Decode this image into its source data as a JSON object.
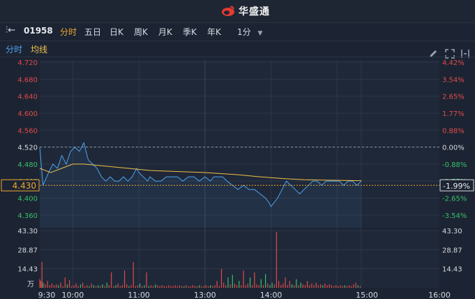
{
  "brand": {
    "name": "华盛通"
  },
  "toolbar": {
    "stock_code": "01958",
    "tabs": [
      {
        "label": "分时",
        "active": true
      },
      {
        "label": "五日",
        "active": false
      },
      {
        "label": "日K",
        "active": false
      },
      {
        "label": "周K",
        "active": false
      },
      {
        "label": "月K",
        "active": false
      },
      {
        "label": "季K",
        "active": false
      },
      {
        "label": "年K",
        "active": false
      }
    ],
    "interval": "1分",
    "icons": [
      "pencil-icon",
      "fullscreen-icon",
      "expand-icon"
    ]
  },
  "legend": {
    "price": "分时",
    "average": "均线"
  },
  "colors": {
    "price_line": "#4ea3f0",
    "avg_line": "#f0c04a",
    "up": "#e24a4a",
    "down": "#38c06a",
    "current": "#f0a632"
  },
  "chart_data": {
    "type": "line",
    "price_ticks": [
      "4.720",
      "4.680",
      "4.640",
      "4.600",
      "4.560",
      "4.520",
      "4.480",
      "4.440",
      "4.400",
      "4.360"
    ],
    "pct_ticks": [
      "4.42%",
      "3.54%",
      "2.65%",
      "1.77%",
      "0.88%",
      "0.00%",
      "-0.88%",
      "-1.77%",
      "-2.65%",
      "-3.54%"
    ],
    "prev_close": 4.52,
    "current_price": "4.430",
    "current_pct": "-1.99%",
    "ylim": [
      4.33,
      4.725
    ],
    "x_labels": [
      "9:30",
      "10:00",
      "11:00",
      "13:00",
      "14:00",
      "15:00",
      "16:00"
    ],
    "volume_ticks": [
      "43.30",
      "28.87",
      "14.43"
    ],
    "volume_unit": "万",
    "price_series": [
      [
        0,
        4.52
      ],
      [
        3,
        4.43
      ],
      [
        8,
        4.46
      ],
      [
        12,
        4.48
      ],
      [
        16,
        4.47
      ],
      [
        20,
        4.5
      ],
      [
        24,
        4.48
      ],
      [
        28,
        4.51
      ],
      [
        32,
        4.52
      ],
      [
        36,
        4.51
      ],
      [
        40,
        4.53
      ],
      [
        44,
        4.49
      ],
      [
        48,
        4.48
      ],
      [
        52,
        4.47
      ],
      [
        56,
        4.45
      ],
      [
        60,
        4.44
      ],
      [
        64,
        4.45
      ],
      [
        68,
        4.44
      ],
      [
        72,
        4.44
      ],
      [
        76,
        4.45
      ],
      [
        80,
        4.44
      ],
      [
        84,
        4.45
      ],
      [
        88,
        4.47
      ],
      [
        90,
        4.46
      ],
      [
        94,
        4.45
      ],
      [
        98,
        4.44
      ],
      [
        100,
        4.45
      ],
      [
        105,
        4.44
      ],
      [
        110,
        4.44
      ],
      [
        115,
        4.45
      ],
      [
        120,
        4.45
      ],
      [
        125,
        4.45
      ],
      [
        130,
        4.44
      ],
      [
        135,
        4.45
      ],
      [
        140,
        4.45
      ],
      [
        145,
        4.44
      ],
      [
        150,
        4.45
      ],
      [
        155,
        4.44
      ],
      [
        158,
        4.45
      ],
      [
        162,
        4.45
      ],
      [
        166,
        4.45
      ],
      [
        170,
        4.44
      ],
      [
        175,
        4.43
      ],
      [
        180,
        4.42
      ],
      [
        185,
        4.43
      ],
      [
        190,
        4.42
      ],
      [
        195,
        4.42
      ],
      [
        200,
        4.41
      ],
      [
        205,
        4.4
      ],
      [
        208,
        4.39
      ],
      [
        210,
        4.38
      ],
      [
        213,
        4.39
      ],
      [
        216,
        4.4
      ],
      [
        220,
        4.42
      ],
      [
        224,
        4.44
      ],
      [
        228,
        4.43
      ],
      [
        232,
        4.42
      ],
      [
        236,
        4.41
      ],
      [
        240,
        4.42
      ],
      [
        244,
        4.43
      ],
      [
        248,
        4.44
      ],
      [
        252,
        4.44
      ],
      [
        256,
        4.43
      ],
      [
        260,
        4.44
      ],
      [
        264,
        4.44
      ],
      [
        268,
        4.44
      ],
      [
        272,
        4.44
      ],
      [
        276,
        4.43
      ],
      [
        280,
        4.44
      ],
      [
        284,
        4.44
      ],
      [
        288,
        4.43
      ],
      [
        292,
        4.44
      ]
    ],
    "avg_series": [
      [
        0,
        4.47
      ],
      [
        10,
        4.46
      ],
      [
        20,
        4.47
      ],
      [
        30,
        4.48
      ],
      [
        40,
        4.48
      ],
      [
        60,
        4.475
      ],
      [
        80,
        4.47
      ],
      [
        100,
        4.465
      ],
      [
        120,
        4.463
      ],
      [
        150,
        4.46
      ],
      [
        180,
        4.455
      ],
      [
        200,
        4.45
      ],
      [
        220,
        4.446
      ],
      [
        240,
        4.443
      ],
      [
        260,
        4.442
      ],
      [
        292,
        4.441
      ]
    ],
    "volume_series": [
      [
        0,
        10
      ],
      [
        1,
        8
      ],
      [
        2,
        30
      ],
      [
        3,
        6
      ],
      [
        5,
        4
      ],
      [
        7,
        8
      ],
      [
        9,
        3
      ],
      [
        11,
        5
      ],
      [
        13,
        3
      ],
      [
        15,
        4
      ],
      [
        17,
        3
      ],
      [
        19,
        6
      ],
      [
        21,
        2
      ],
      [
        23,
        12
      ],
      [
        25,
        4
      ],
      [
        27,
        9
      ],
      [
        29,
        2
      ],
      [
        31,
        3
      ],
      [
        33,
        5
      ],
      [
        35,
        2
      ],
      [
        37,
        4
      ],
      [
        39,
        6
      ],
      [
        41,
        2
      ],
      [
        43,
        3
      ],
      [
        45,
        2
      ],
      [
        47,
        5
      ],
      [
        49,
        3
      ],
      [
        51,
        2
      ],
      [
        53,
        3
      ],
      [
        55,
        2
      ],
      [
        57,
        4
      ],
      [
        59,
        2
      ],
      [
        61,
        6
      ],
      [
        63,
        3
      ],
      [
        65,
        18
      ],
      [
        67,
        2
      ],
      [
        69,
        3
      ],
      [
        71,
        5
      ],
      [
        73,
        2
      ],
      [
        75,
        3
      ],
      [
        77,
        20
      ],
      [
        79,
        4
      ],
      [
        81,
        2
      ],
      [
        83,
        3
      ],
      [
        85,
        30
      ],
      [
        87,
        2
      ],
      [
        89,
        3
      ],
      [
        91,
        5
      ],
      [
        93,
        2
      ],
      [
        95,
        3
      ],
      [
        97,
        18
      ],
      [
        99,
        2
      ],
      [
        101,
        3
      ],
      [
        103,
        2
      ],
      [
        105,
        4
      ],
      [
        107,
        3
      ],
      [
        109,
        2
      ],
      [
        111,
        3
      ],
      [
        113,
        2
      ],
      [
        115,
        2
      ],
      [
        117,
        3
      ],
      [
        119,
        2
      ],
      [
        121,
        2
      ],
      [
        123,
        3
      ],
      [
        125,
        2
      ],
      [
        127,
        3
      ],
      [
        129,
        2
      ],
      [
        131,
        2
      ],
      [
        133,
        3
      ],
      [
        135,
        2
      ],
      [
        137,
        2
      ],
      [
        139,
        3
      ],
      [
        141,
        2
      ],
      [
        143,
        2
      ],
      [
        145,
        3
      ],
      [
        147,
        2
      ],
      [
        149,
        2
      ],
      [
        151,
        3
      ],
      [
        153,
        2
      ],
      [
        155,
        3
      ],
      [
        157,
        2
      ],
      [
        159,
        3
      ],
      [
        161,
        8
      ],
      [
        163,
        2
      ],
      [
        165,
        22
      ],
      [
        167,
        6
      ],
      [
        169,
        3
      ],
      [
        171,
        12
      ],
      [
        173,
        4
      ],
      [
        175,
        15
      ],
      [
        177,
        5
      ],
      [
        179,
        3
      ],
      [
        181,
        8
      ],
      [
        183,
        3
      ],
      [
        185,
        20
      ],
      [
        187,
        3
      ],
      [
        189,
        5
      ],
      [
        191,
        12
      ],
      [
        193,
        3
      ],
      [
        195,
        18
      ],
      [
        197,
        4
      ],
      [
        199,
        3
      ],
      [
        201,
        10
      ],
      [
        203,
        3
      ],
      [
        205,
        16
      ],
      [
        207,
        5
      ],
      [
        209,
        3
      ],
      [
        211,
        6
      ],
      [
        213,
        4
      ],
      [
        215,
        65
      ],
      [
        217,
        8
      ],
      [
        219,
        3
      ],
      [
        221,
        5
      ],
      [
        223,
        12
      ],
      [
        225,
        3
      ],
      [
        227,
        8
      ],
      [
        229,
        4
      ],
      [
        231,
        3
      ],
      [
        233,
        10
      ],
      [
        235,
        3
      ],
      [
        237,
        6
      ],
      [
        239,
        4
      ],
      [
        241,
        3
      ],
      [
        243,
        8
      ],
      [
        245,
        3
      ],
      [
        247,
        5
      ],
      [
        249,
        3
      ],
      [
        251,
        6
      ],
      [
        253,
        3
      ],
      [
        255,
        4
      ],
      [
        257,
        3
      ],
      [
        259,
        5
      ],
      [
        261,
        3
      ],
      [
        263,
        4
      ],
      [
        265,
        3
      ],
      [
        267,
        2
      ],
      [
        269,
        3
      ],
      [
        271,
        2
      ],
      [
        273,
        3
      ],
      [
        275,
        2
      ],
      [
        277,
        3
      ],
      [
        279,
        2
      ],
      [
        281,
        3
      ],
      [
        283,
        2
      ],
      [
        285,
        4
      ],
      [
        287,
        6
      ],
      [
        289,
        3
      ],
      [
        291,
        2
      ]
    ]
  }
}
